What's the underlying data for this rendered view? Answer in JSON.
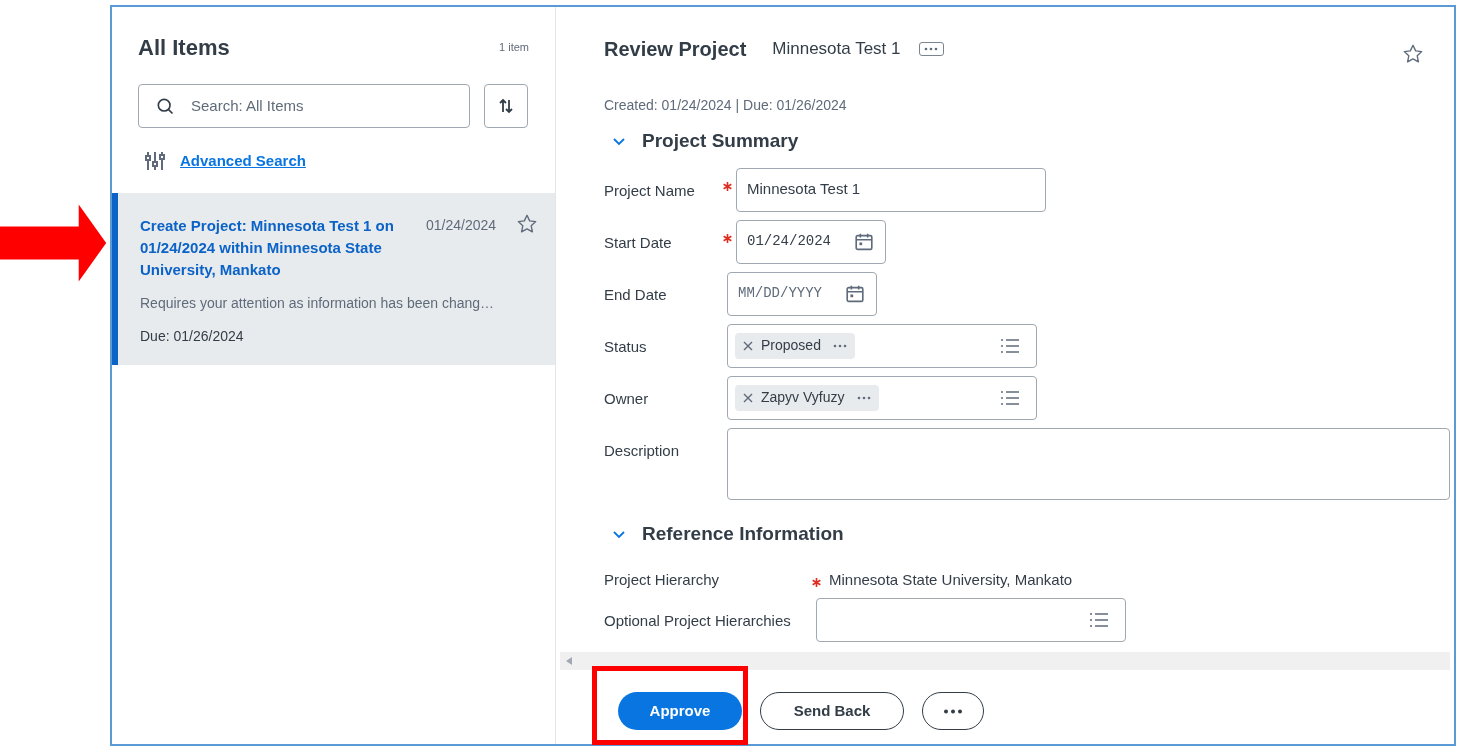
{
  "list_panel": {
    "title": "All Items",
    "count": "1 item",
    "search": {
      "placeholder": "Search: All Items"
    },
    "advanced_search": "Advanced Search",
    "items": [
      {
        "title": "Create Project: Minnesota Test 1 on 01/24/2024 within Minnesota State University, Mankato",
        "date": "01/24/2024",
        "summary": "Requires your attention as information has been chang…",
        "due": "Due: 01/26/2024",
        "selected": true,
        "starred": false,
        "pointed_at": true
      }
    ]
  },
  "detail": {
    "title": "Review Project",
    "subtitle": "Minnesota Test 1",
    "starred": false,
    "meta": "Created: 01/24/2024 | Due: 01/26/2024",
    "sections": [
      {
        "title": "Project Summary",
        "expanded": true,
        "fields": [
          {
            "kind": "text",
            "label": "Project Name",
            "required": true,
            "value": "Minnesota Test 1"
          },
          {
            "kind": "date",
            "label": "Start Date",
            "required": true,
            "value": "01/24/2024"
          },
          {
            "kind": "date",
            "label": "End Date",
            "required": false,
            "placeholder": "MM/DD/YYYY"
          },
          {
            "kind": "multiselect",
            "label": "Status",
            "required": false,
            "chips": [
              "Proposed"
            ]
          },
          {
            "kind": "multiselect",
            "label": "Owner",
            "required": false,
            "chips": [
              "Zapyv Vyfuzy"
            ]
          },
          {
            "kind": "textarea",
            "label": "Description",
            "required": false
          }
        ]
      },
      {
        "title": "Reference Information",
        "expanded": true,
        "fields": [
          {
            "kind": "readonly",
            "label": "Project Hierarchy",
            "required": true,
            "value": "Minnesota State University, Mankato"
          },
          {
            "kind": "multiselect",
            "label": "Optional Project Hierarchies",
            "required": false
          }
        ]
      }
    ]
  },
  "actions": [
    {
      "kind": "primary",
      "label": "Approve",
      "highlighted": true
    },
    {
      "kind": "secondary",
      "label": "Send Back",
      "highlighted": false
    },
    {
      "kind": "more",
      "highlighted": false
    }
  ]
}
